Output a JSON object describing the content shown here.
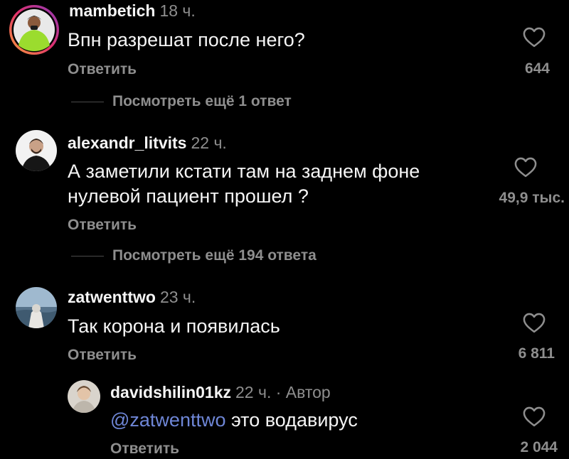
{
  "theme": {
    "background": "#000000",
    "text": "#f5f5f5",
    "muted": "#8e8e8e",
    "mention": "#6e86d6",
    "story_ring": [
      "#f9a23a",
      "#e1306c",
      "#8a3ab9"
    ]
  },
  "comments": [
    {
      "username": "mambetich",
      "time": "18 ч.",
      "text": "Впн разрешат после него?",
      "reply_label": "Ответить",
      "likes": "644",
      "avatar_icon": "avatar-green-shirt-person",
      "view_more": "Посмотреть ещё 1 ответ"
    },
    {
      "username": "alexandr_litvits",
      "time": "22 ч.",
      "text_lines": [
        "А заметили кстати там на заднем фоне",
        "нулевой пациент прошел ?"
      ],
      "reply_label": "Ответить",
      "likes": "49,9 тыс.",
      "avatar_icon": "avatar-man-black-shirt",
      "view_more": "Посмотреть ещё 194 ответа"
    },
    {
      "username": "zatwenttwo",
      "time": "23 ч.",
      "text": "Так корона и появилась",
      "reply_label": "Ответить",
      "likes": "6 811",
      "avatar_icon": "avatar-sea-sky-photo"
    },
    {
      "username": "davidshilin01kz",
      "time": "22 ч. · Автор",
      "mention": "@zatwenttwo",
      "text": " это водавирус",
      "reply_label": "Ответить",
      "likes": "2 044",
      "avatar_icon": "avatar-young-man"
    }
  ]
}
